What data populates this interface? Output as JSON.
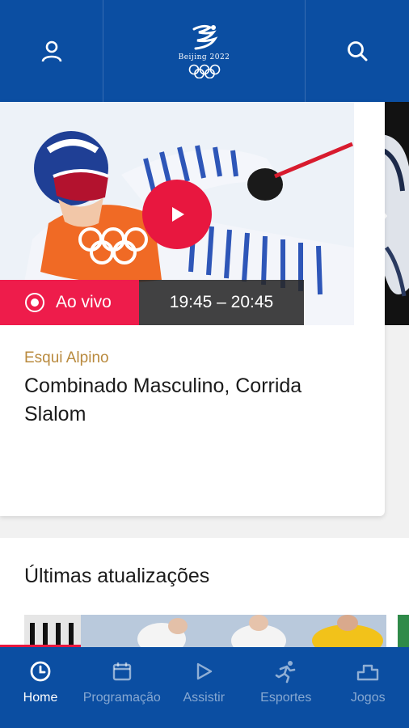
{
  "header": {
    "profile_icon": "person-icon",
    "logo_text": "Beijing 2022",
    "search_icon": "search-icon"
  },
  "featured": {
    "live_label": "Ao vivo",
    "time_range": "19:45 – 20:45",
    "sport": "Esqui Alpino",
    "title": "Combinado Masculino, Corrida Slalom",
    "play_icon": "play-icon",
    "next_icon": "chevron-right-icon"
  },
  "updates": {
    "title": "Últimas atualizações"
  },
  "nav": {
    "items": [
      {
        "label": "Home",
        "icon": "clock-icon",
        "active": true
      },
      {
        "label": "Programação",
        "icon": "calendar-icon",
        "active": false
      },
      {
        "label": "Assistir",
        "icon": "play-outline-icon",
        "active": false
      },
      {
        "label": "Esportes",
        "icon": "athlete-icon",
        "active": false
      },
      {
        "label": "Jogos",
        "icon": "podium-icon",
        "active": false
      }
    ]
  },
  "colors": {
    "brand_blue": "#0b4ea2",
    "live_red": "#ee1c4b",
    "sport_gold": "#b98a3e"
  }
}
